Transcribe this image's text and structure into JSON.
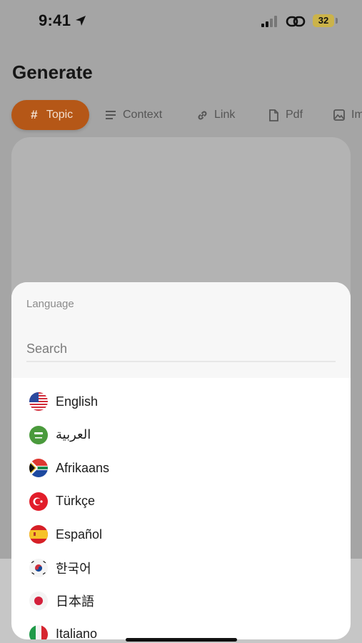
{
  "status_bar": {
    "time": "9:41",
    "battery": "32"
  },
  "header": {
    "title": "Generate"
  },
  "tabs": [
    {
      "label": "Topic",
      "icon": "hash-icon",
      "active": true
    },
    {
      "label": "Context",
      "icon": "lines-icon"
    },
    {
      "label": "Link",
      "icon": "link-icon"
    },
    {
      "label": "Pdf",
      "icon": "document-icon"
    },
    {
      "label": "Im",
      "icon": "image-icon"
    }
  ],
  "sheet": {
    "title": "Language",
    "search": {
      "placeholder": "Search",
      "value": ""
    },
    "languages": [
      {
        "label": "English",
        "flag": "us-flag-icon"
      },
      {
        "label": "العربية",
        "flag": "saudi-flag-icon"
      },
      {
        "label": "Afrikaans",
        "flag": "south-africa-flag-icon"
      },
      {
        "label": "Türkçe",
        "flag": "turkey-flag-icon"
      },
      {
        "label": "Español",
        "flag": "spain-flag-icon"
      },
      {
        "label": "한국어",
        "flag": "korea-flag-icon"
      },
      {
        "label": "日本語",
        "flag": "japan-flag-icon"
      },
      {
        "label": "Italiano",
        "flag": "italy-flag-icon"
      }
    ]
  },
  "colors": {
    "accent": "#b55717",
    "overlay": "#a5a5a5",
    "sheet": "#ffffff"
  }
}
